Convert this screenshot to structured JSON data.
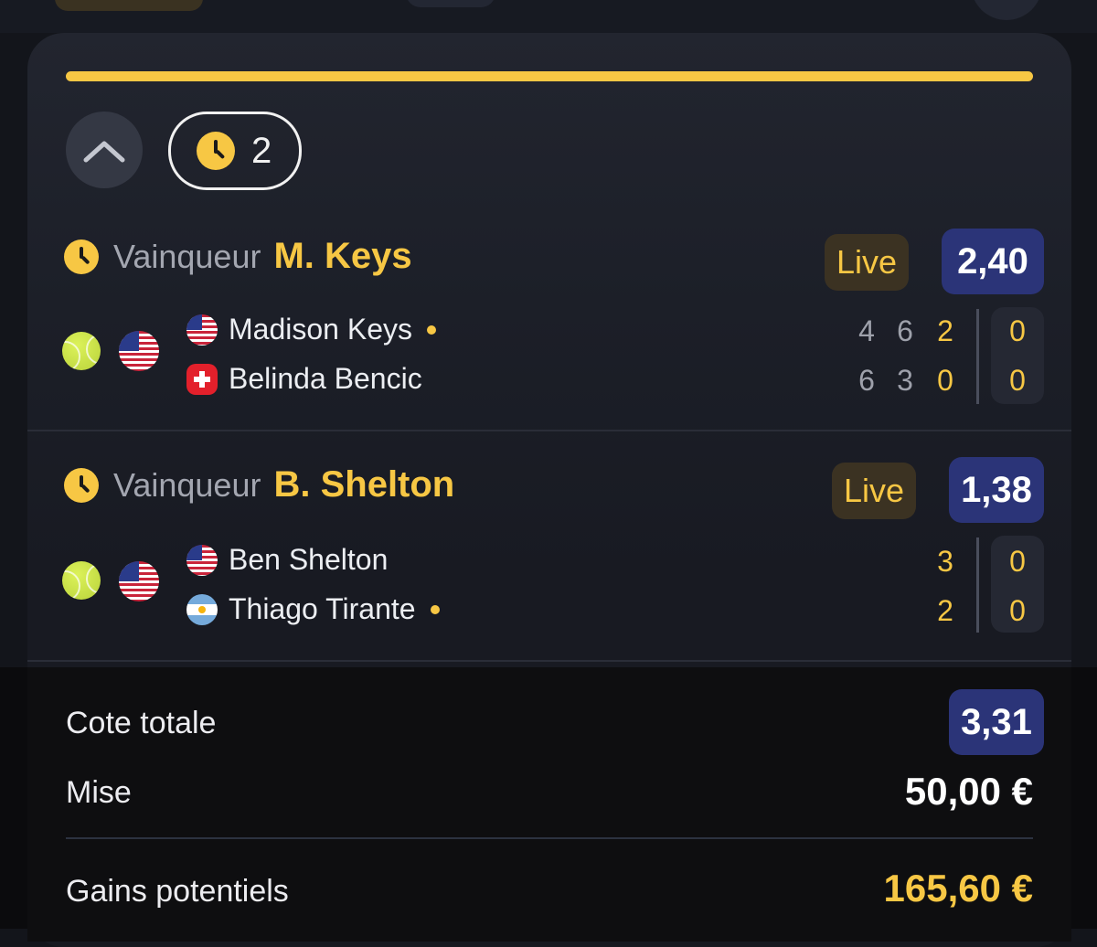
{
  "pending": {
    "count": "2"
  },
  "bets": [
    {
      "label": "Vainqueur",
      "selection": "M. Keys",
      "live": "Live",
      "odds": "2,40",
      "players": [
        {
          "name": "Madison Keys",
          "flag": "us-flag",
          "serving": true,
          "sets": [
            "4",
            "6",
            "2"
          ],
          "points": "0"
        },
        {
          "name": "Belinda Bencic",
          "flag": "switzerland-flag",
          "serving": false,
          "sets": [
            "6",
            "3",
            "0"
          ],
          "points": "0"
        }
      ]
    },
    {
      "label": "Vainqueur",
      "selection": "B. Shelton",
      "live": "Live",
      "odds": "1,38",
      "players": [
        {
          "name": "Ben Shelton",
          "flag": "us-flag",
          "serving": false,
          "sets": [
            "3"
          ],
          "points": "0"
        },
        {
          "name": "Thiago Tirante",
          "flag": "argentina-flag",
          "serving": true,
          "sets": [
            "2"
          ],
          "points": "0"
        }
      ]
    }
  ],
  "summary": {
    "total_odds_label": "Cote totale",
    "total_odds": "3,31",
    "stake_label": "Mise",
    "stake": "50,00 €",
    "winnings_label": "Gains potentiels",
    "winnings": "165,60 €"
  },
  "colors": {
    "accent": "#f7c744",
    "odds_bg": "#2b3478",
    "background": "#13151b"
  }
}
